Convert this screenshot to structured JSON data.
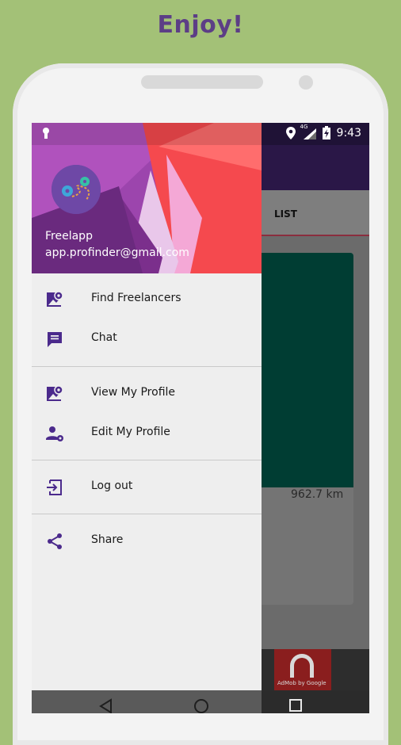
{
  "headline": "Enjoy!",
  "status_bar": {
    "network": "4G",
    "time": "9:43"
  },
  "background_app": {
    "tab_label": "LIST",
    "distance": "962.7 km",
    "ad_label": "AdMob by Google"
  },
  "drawer": {
    "header": {
      "app_name": "Freelapp",
      "email": "app.profinder@gmail.com"
    },
    "items": [
      {
        "label": "Find Freelancers",
        "icon": "map-marker-icon"
      },
      {
        "label": "Chat",
        "icon": "chat-icon"
      },
      {
        "label": "View My Profile",
        "icon": "map-marker-icon"
      },
      {
        "label": "Edit My Profile",
        "icon": "person-settings-icon"
      },
      {
        "label": "Log out",
        "icon": "logout-icon"
      },
      {
        "label": "Share",
        "icon": "share-icon"
      }
    ]
  },
  "colors": {
    "background": "#a3c177",
    "headline": "#5c3e86",
    "accent": "#4b2a8c",
    "drawer_bg": "#eeeeee"
  }
}
